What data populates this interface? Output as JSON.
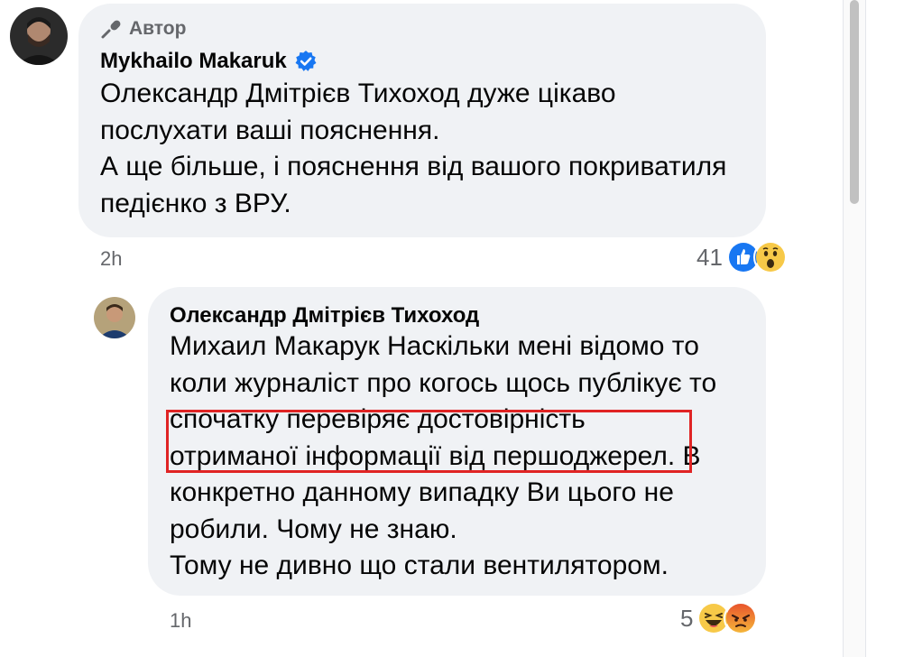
{
  "comments": [
    {
      "author_badge": "Автор",
      "name": "Mykhailo Makaruk",
      "verified_icon": "verified-badge-icon",
      "lines": [
        "Олександр Дмітрієв Тихоход дуже цікаво",
        "послухати ваші пояснення.",
        "А ще більше, і пояснення від вашого покриватиля",
        "педієнко з ВРУ."
      ],
      "time": "2h",
      "reaction_count": "41",
      "reactions": [
        "like-icon",
        "wow-icon"
      ]
    },
    {
      "name": "Олександр Дмітрієв Тихоход",
      "lines": [
        "Михаил Макарук Наскільки мені відомо то",
        "коли журналіст про когось щось публікує то",
        "спочатку перевіряє достовірність",
        "отриманої інформації від першоджерел. В",
        "конкретно данному випадку Ви цього не",
        "робили. Чому не знаю.",
        "Тому не дивно що стали вентилятором."
      ],
      "time": "1h",
      "reaction_count": "5",
      "reactions": [
        "haha-icon",
        "angry-icon"
      ]
    }
  ],
  "colors": {
    "bubble": "#f0f2f5",
    "meta_text": "#65676b",
    "verified": "#1877f2",
    "highlight": "#e02424"
  }
}
